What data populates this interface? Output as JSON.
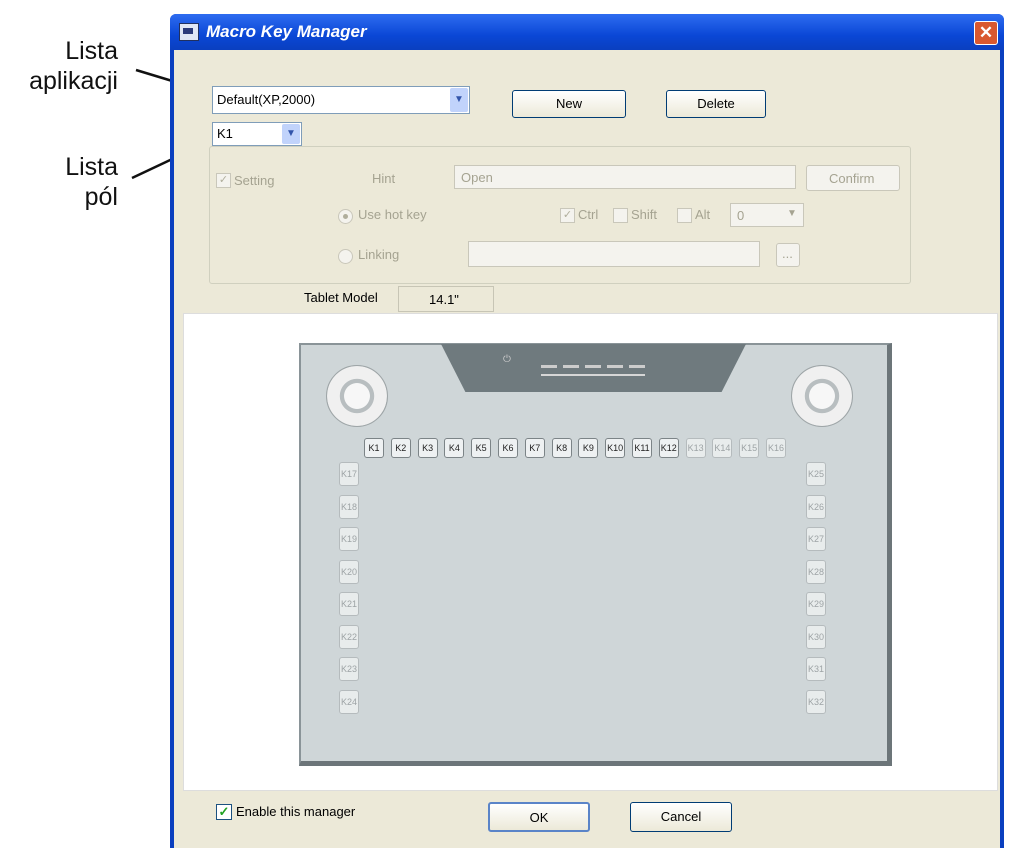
{
  "annotations": {
    "app_list_label": "Lista\naplikacji",
    "field_list_label": "Lista\npól"
  },
  "window": {
    "title": "Macro Key Manager",
    "close_glyph": "✕"
  },
  "top_controls": {
    "application_select_value": "Default(XP,2000)",
    "new_button": "New",
    "delete_button": "Delete",
    "key_select_value": "K1"
  },
  "settings": {
    "setting_label": "Setting",
    "hint_label": "Hint",
    "hint_value": "Open",
    "confirm_button": "Confirm",
    "use_hot_key_label": "Use hot key",
    "ctrl_label": "Ctrl",
    "shift_label": "Shift",
    "alt_label": "Alt",
    "key_value": "0",
    "linking_label": "Linking",
    "browse_button": "..."
  },
  "tablet_model": {
    "label": "Tablet Model",
    "value": "14.1\""
  },
  "tablet": {
    "top_keys": [
      "K1",
      "K2",
      "K3",
      "K4",
      "K5",
      "K6",
      "K7",
      "K8",
      "K9",
      "K10",
      "K11",
      "K12",
      "K13",
      "K14",
      "K15",
      "K16"
    ],
    "left_keys": [
      "K17",
      "K18",
      "K19",
      "K20",
      "K21",
      "K22",
      "K23",
      "K24"
    ],
    "right_keys": [
      "K25",
      "K26",
      "K27",
      "K28",
      "K29",
      "K30",
      "K31",
      "K32"
    ]
  },
  "footer": {
    "enable_label": "Enable this manager",
    "enable_checked": true,
    "ok_button": "OK",
    "cancel_button": "Cancel"
  }
}
